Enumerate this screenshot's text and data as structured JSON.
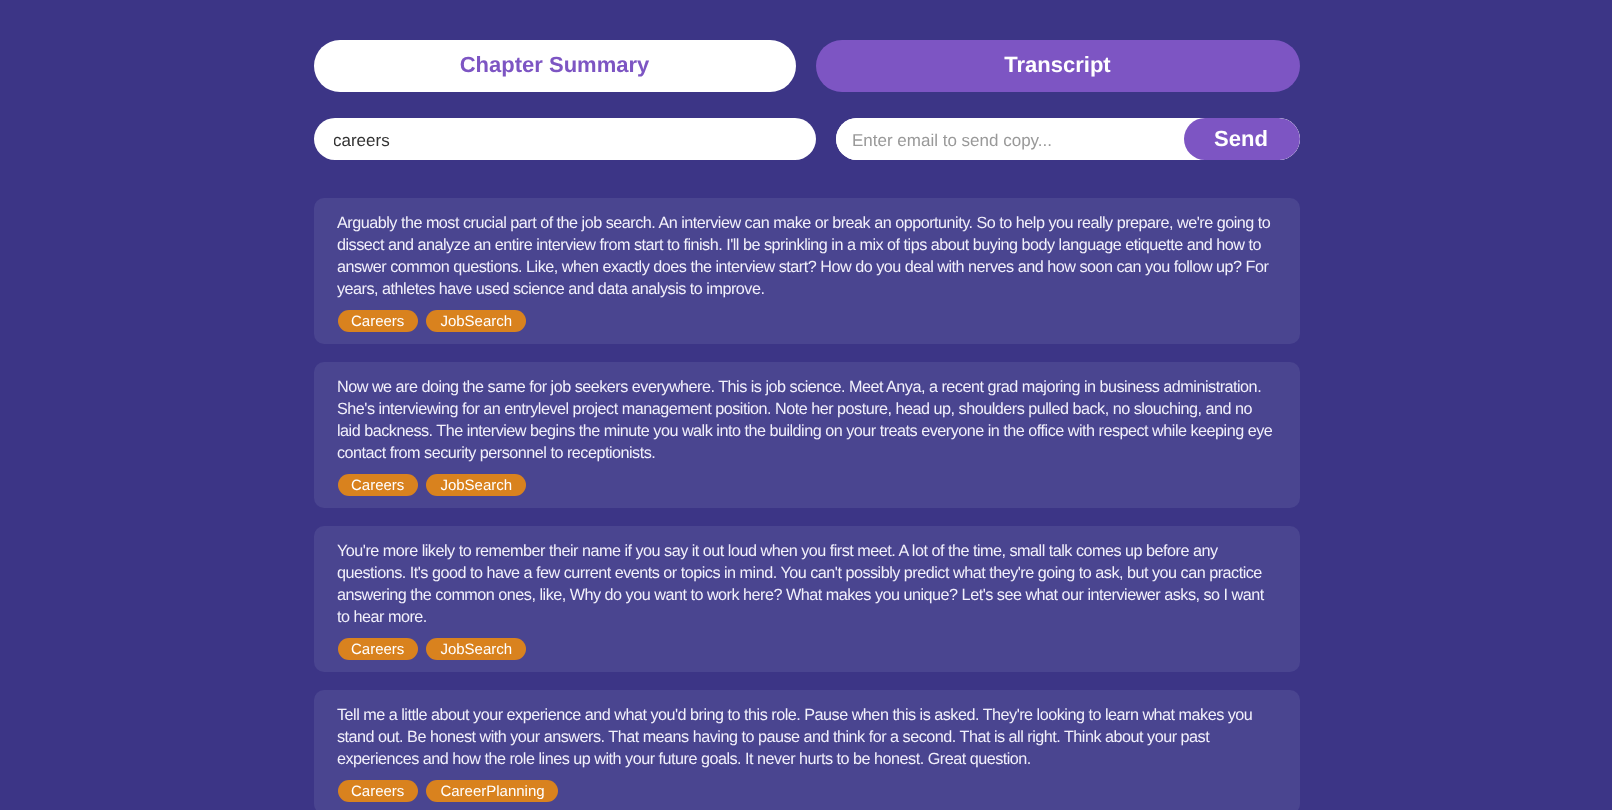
{
  "tabs": [
    {
      "label": "Chapter Summary",
      "selected": false
    },
    {
      "label": "Transcript",
      "selected": true
    }
  ],
  "search": {
    "value": "careers"
  },
  "email": {
    "placeholder": "Enter email to send copy...",
    "button": "Send"
  },
  "segments": [
    {
      "text": "Arguably the most crucial part of the job search. An interview can make or break an opportunity. So to help you really prepare, we're going to dissect and analyze an entire interview from start to finish. I'll be sprinkling in a mix of tips about buying body language etiquette and how to answer common questions. Like, when exactly does the interview start? How do you deal with nerves and how soon can you follow up? For years, athletes have used science and data analysis to improve.",
      "tags": [
        "Careers",
        "JobSearch"
      ]
    },
    {
      "text": "Now we are doing the same for job seekers everywhere. This is job science. Meet Anya, a recent grad majoring in business administration. She's interviewing for an entrylevel project management position. Note her posture, head up, shoulders pulled back, no slouching, and no laid backness. The interview begins the minute you walk into the building on your treats everyone in the office with respect while keeping eye contact from security personnel to receptionists.",
      "tags": [
        "Careers",
        "JobSearch"
      ]
    },
    {
      "text": "You're more likely to remember their name if you say it out loud when you first meet. A lot of the time, small talk comes up before any questions. It's good to have a few current events or topics in mind. You can't possibly predict what they're going to ask, but you can practice answering the common ones, like, Why do you want to work here? What makes you unique? Let's see what our interviewer asks, so I want to hear more.",
      "tags": [
        "Careers",
        "JobSearch"
      ]
    },
    {
      "text": "Tell me a little about your experience and what you'd bring to this role. Pause when this is asked. They're looking to learn what makes you stand out. Be honest with your answers. That means having to pause and think for a second. That is all right. Think about your past experiences and how the role lines up with your future goals. It never hurts to be honest. Great question.",
      "tags": [
        "Careers",
        "CareerPlanning"
      ]
    }
  ]
}
